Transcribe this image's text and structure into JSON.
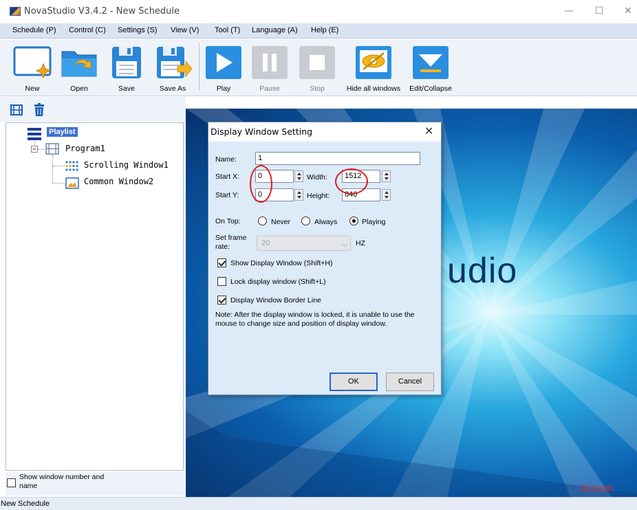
{
  "window": {
    "title": "NovaStudio V3.4.2 - New Schedule",
    "controls": {
      "minimize": "—",
      "maximize": "☐",
      "close": "✕"
    }
  },
  "menu": [
    "Schedule (P)",
    "Control (C)",
    "Settings (S)",
    "View (V)",
    "Tool (T)",
    "Language (A)",
    "Help (E)"
  ],
  "toolbar": {
    "new": "New",
    "open": "Open",
    "save": "Save",
    "save_as": "Save As",
    "play": "Play",
    "pause": "Pause",
    "stop": "Stop",
    "hide_all": "Hide all windows",
    "edit_collapse": "Edit/Collapse"
  },
  "tree": {
    "root": "Playlist",
    "program": "Program1",
    "windows": [
      "Scrolling Window1",
      "Common Window2"
    ]
  },
  "bottom": {
    "show_window_number": "Show window number and name",
    "show_window_number_checked": false
  },
  "status": {
    "text": "New Schedule"
  },
  "preview": {
    "logo_fragment": "udio",
    "set_screen": "Set screen"
  },
  "dialog": {
    "title": "Display Window Setting",
    "close": "✕",
    "name_label": "Name:",
    "name_value": "1",
    "start_x_label": "Start X:",
    "start_x_value": "0",
    "width_label": "Width:",
    "width_value": "1512",
    "start_y_label": "Start Y:",
    "start_y_value": "0",
    "height_label": "Height:",
    "height_value": "840",
    "on_top_label": "On Top:",
    "on_top_options": [
      "Never",
      "Always",
      "Playing"
    ],
    "on_top_selected": "Playing",
    "frame_rate_label": "Set frame rate:",
    "frame_rate_value": "20",
    "frame_rate_unit": "HZ",
    "check_show": "Show Display Window (Shift+H)",
    "check_show_checked": true,
    "check_lock": "Lock display window (Shift+L)",
    "check_lock_checked": false,
    "check_border": "Display Window Border Line",
    "check_border_checked": true,
    "note": "Note: After the display window is locked, it is unable to use the mouse to change size and position of display window.",
    "ok": "OK",
    "cancel": "Cancel"
  },
  "colors": {
    "menu_bg": "#d9e4f3",
    "toolbar_bg": "#eef3fa",
    "selection": "#3b6fd1",
    "dialog_bg": "#ddeaf8",
    "annotation": "#e11d1d",
    "set_screen": "#e02a2a"
  }
}
